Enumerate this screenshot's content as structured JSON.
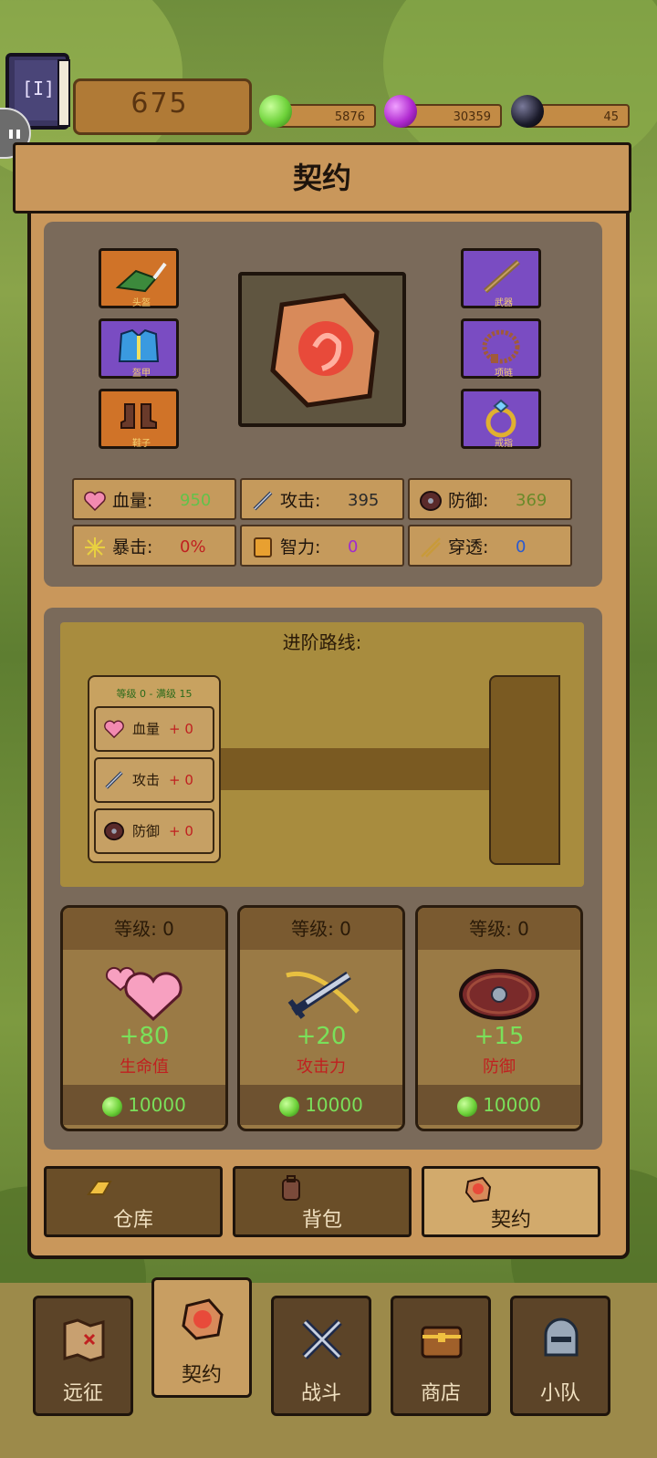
{
  "top_bar": {
    "score": "675",
    "gems": [
      {
        "name": "green-gem",
        "value": "5876",
        "color": "#6ed23a"
      },
      {
        "name": "purple-gem",
        "value": "30359",
        "color": "#b02ad0"
      },
      {
        "name": "dark-gem",
        "value": "45",
        "color": "#1a1a2a"
      }
    ]
  },
  "panel_title": "契约",
  "equipment": {
    "left_slots": [
      {
        "icon": "hat-icon",
        "caption": "头盔"
      },
      {
        "icon": "armor-icon",
        "caption": "盔甲"
      },
      {
        "icon": "boots-icon",
        "caption": "鞋子"
      }
    ],
    "right_slots": [
      {
        "icon": "sword-icon",
        "caption": "武器"
      },
      {
        "icon": "necklace-icon",
        "caption": "项链"
      },
      {
        "icon": "ring-icon",
        "caption": "戒指"
      }
    ],
    "center_icon": "contract-stone-icon"
  },
  "stats": [
    {
      "icon": "heart-icon",
      "label": "血量:",
      "value": "950",
      "color": "#62c24a"
    },
    {
      "icon": "sword-icon",
      "label": "攻击:",
      "value": "395",
      "color": "#2a2a2a"
    },
    {
      "icon": "shield-icon",
      "label": "防御:",
      "value": "369",
      "color": "#6a8a2a"
    },
    {
      "icon": "burst-icon",
      "label": "暴击:",
      "value": "0%",
      "color": "#c02020"
    },
    {
      "icon": "book-icon",
      "label": "智力:",
      "value": "0",
      "color": "#a02ad0"
    },
    {
      "icon": "arrow-icon",
      "label": "穿透:",
      "value": "0",
      "color": "#2a5ad0"
    }
  ],
  "route": {
    "title": "进阶路线:",
    "card_header": "等级 0 - 满级 15",
    "rows": [
      {
        "icon": "heart-icon",
        "label": "血量",
        "suffix": "+ 0"
      },
      {
        "icon": "sword-icon",
        "label": "攻击",
        "suffix": "+ 0"
      },
      {
        "icon": "shield-icon",
        "label": "防御",
        "suffix": "+ 0"
      }
    ]
  },
  "upgrades": [
    {
      "icon": "big-heart-icon",
      "level": "等级: 0",
      "bonus": "+80",
      "name": "生命值",
      "cost": "10000"
    },
    {
      "icon": "big-sword-icon",
      "level": "等级: 0",
      "bonus": "+20",
      "name": "攻击力",
      "cost": "10000"
    },
    {
      "icon": "big-shield-icon",
      "level": "等级: 0",
      "bonus": "+15",
      "name": "防御",
      "cost": "10000"
    }
  ],
  "tabs": [
    {
      "icon": "gold-bar-icon",
      "label": "仓库"
    },
    {
      "icon": "backpack-icon",
      "label": "背包"
    },
    {
      "icon": "contract-stone-icon",
      "label": "契约"
    }
  ],
  "nav": [
    {
      "icon": "map-icon",
      "label": "远征"
    },
    {
      "icon": "contract-stone-icon",
      "label": "契约"
    },
    {
      "icon": "crossed-swords-icon",
      "label": "战斗"
    },
    {
      "icon": "chest-icon",
      "label": "商店"
    },
    {
      "icon": "helmet-icon",
      "label": "小队"
    }
  ],
  "colors": {
    "panel": "#c9975b",
    "panel_dark": "#7a6a5a",
    "positive_green": "#7ae05a",
    "negative_red": "#c02020"
  }
}
